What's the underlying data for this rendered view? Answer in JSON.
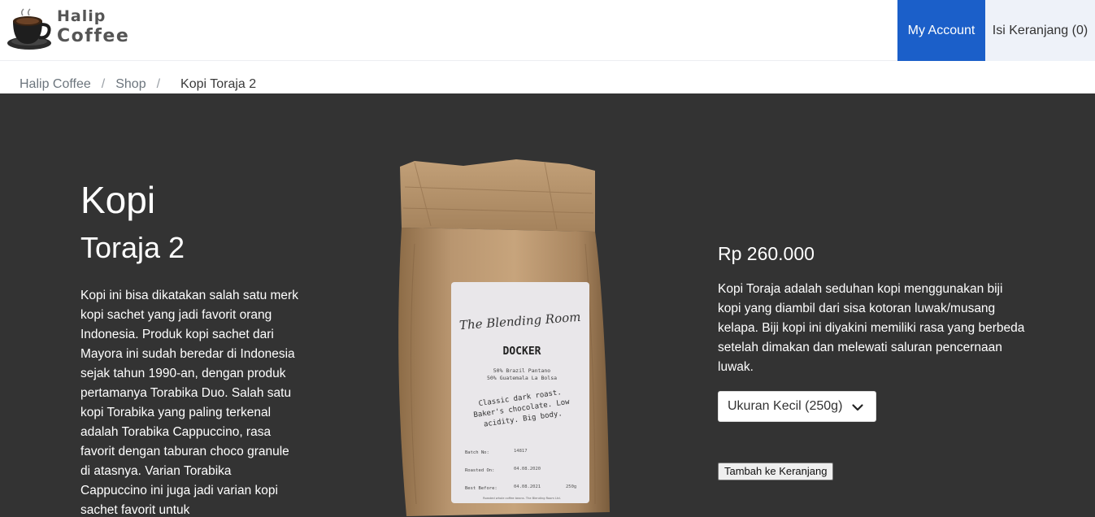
{
  "brand": {
    "line1": "Halip",
    "line2": "Coffee",
    "logo_icon": "coffee-cup-icon"
  },
  "nav": {
    "account_label": "My Account",
    "cart_label": "Isi Keranjang (0)"
  },
  "breadcrumb": {
    "items": [
      "Halip Coffee",
      "Shop"
    ],
    "separator": "/",
    "current": "Kopi Toraja 2"
  },
  "product": {
    "title_line1": "Kopi",
    "title_line2": "Toraja 2",
    "description": "Kopi ini bisa dikatakan salah satu merk kopi sachet yang jadi favorit orang Indonesia. Produk kopi sachet dari Mayora ini sudah beredar di Indonesia sejak tahun 1990-an, dengan produk pertamanya Torabika Duo. Salah satu kopi Torabika yang paling terkenal adalah Torabika Cappuccino, rasa favorit dengan taburan choco granule di atasnya. Varian Torabika Cappuccino ini juga jadi varian kopi sachet favorit untuk",
    "price": "Rp 260.000",
    "detail": "Kopi Toraja adalah seduhan kopi menggunakan biji kopi yang diambil dari sisa kotoran luwak/musang kelapa. Biji kopi ini diyakini memiliki rasa yang berbeda setelah dimakan dan melewati saluran pencernaan luwak.",
    "size_selected": "Ukuran Kecil (250g)",
    "add_to_cart_label": "Tambah ke Keranjang"
  },
  "bag_label": {
    "brand": "The Blending Room",
    "name": "DOCKER",
    "blend_line1": "50% Brazil Pantano",
    "blend_line2": "50% Guatemala La Bolsa",
    "notes_line1": "Classic dark roast.",
    "notes_line2": "Baker's chocolate. Low",
    "notes_line3": "acidity. Big body.",
    "batch_label": "Batch No:",
    "batch_value": "14817",
    "roasted_label": "Roasted On:",
    "roasted_value": "04.08.2020",
    "best_label": "Best Before:",
    "best_value": "04.08.2021",
    "weight": "250g",
    "footer": "Roasted whole coffee beans. The Blending Room Ltd."
  },
  "colors": {
    "accent": "#1b5fc9",
    "cart_bg": "#eef2f9",
    "section_bg": "#333333",
    "bag_paper": "#b08c63"
  }
}
